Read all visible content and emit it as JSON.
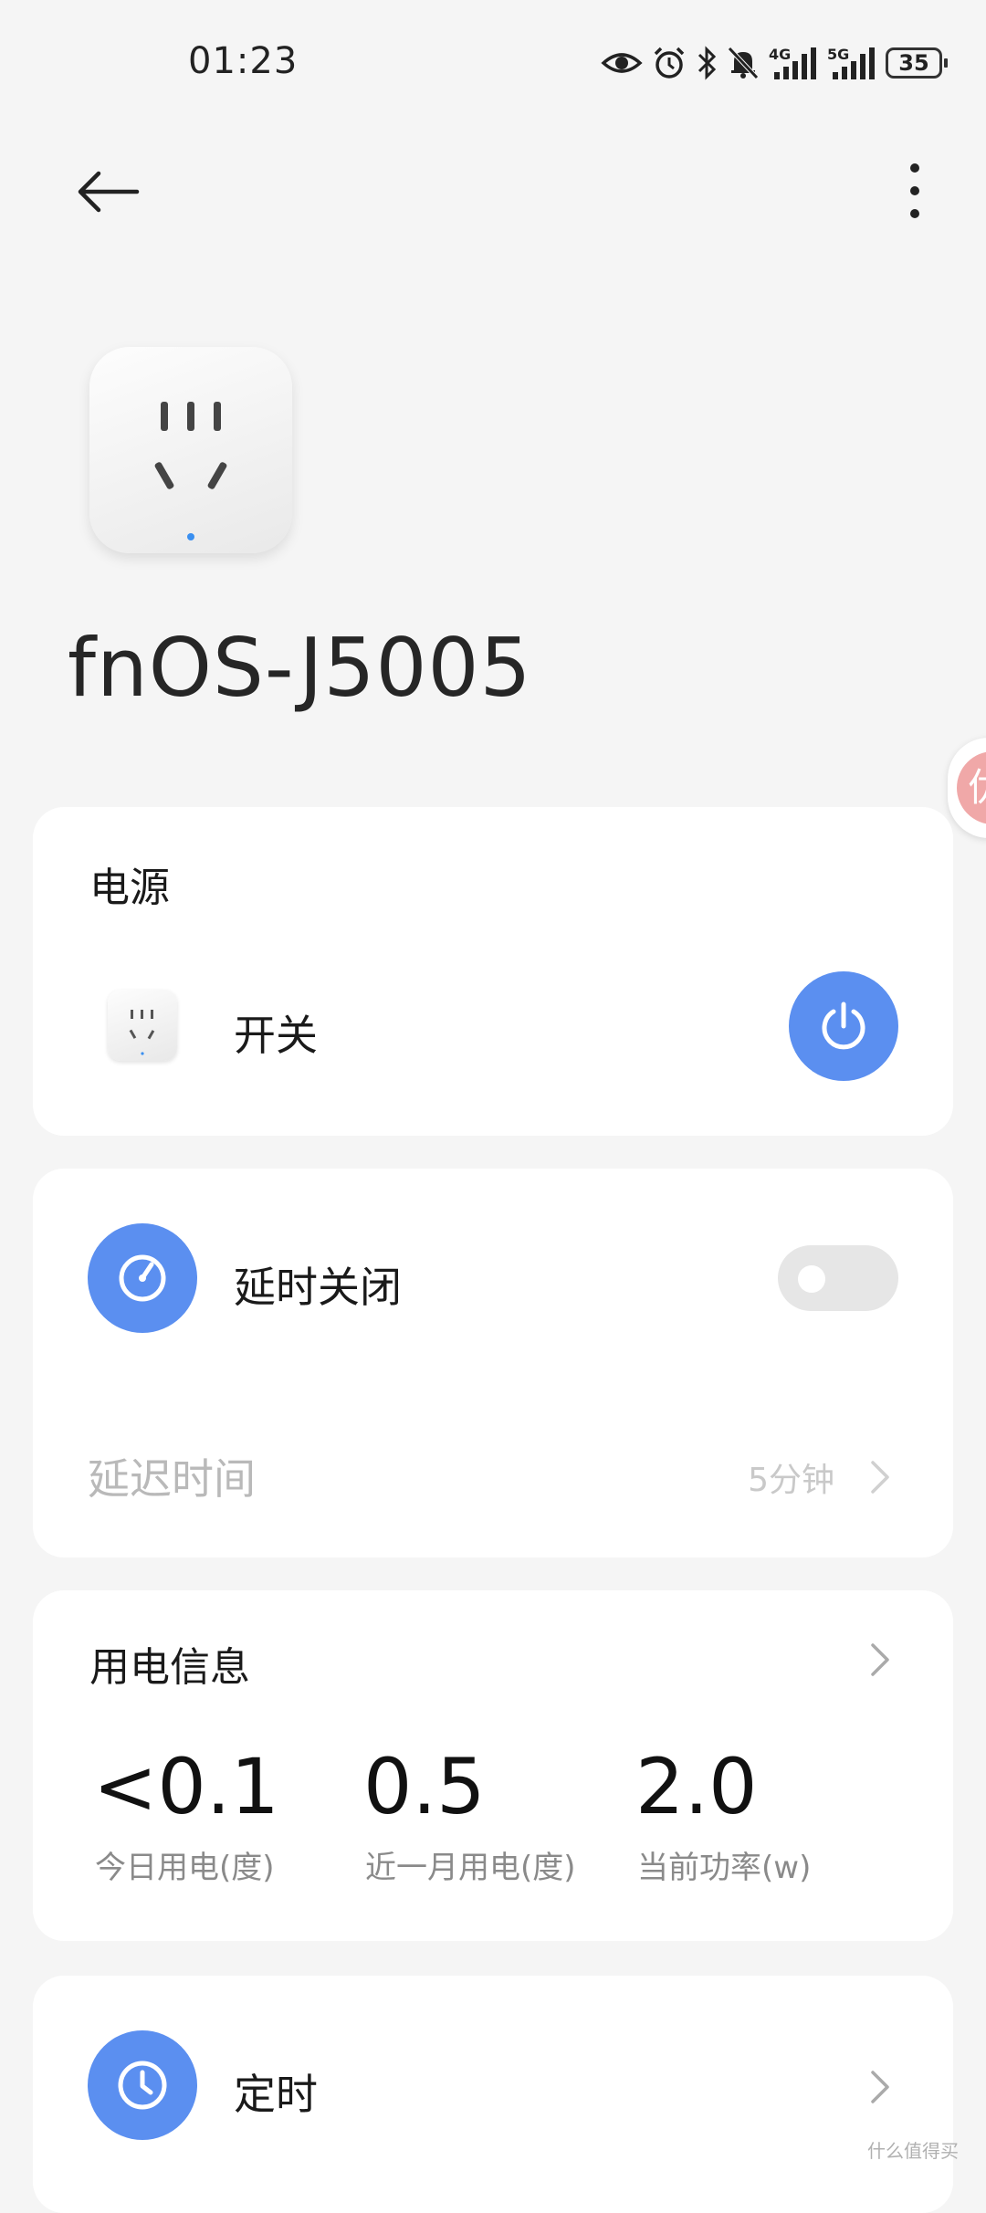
{
  "status_bar": {
    "time": "01:23",
    "icons": [
      "eye-icon",
      "alarm-icon",
      "bluetooth-icon",
      "mute-bell-icon",
      "4g-signal-icon",
      "5g-signal-icon"
    ],
    "net1": "4G",
    "net2": "5G",
    "battery": "35"
  },
  "device": {
    "name": "fnOS-J5005"
  },
  "power_card": {
    "title": "电源",
    "switch_label": "开关"
  },
  "delay_card": {
    "label": "延时关闭",
    "delay_time_label": "延迟时间",
    "delay_time_value": "5分钟",
    "toggle_on": false
  },
  "electricity_card": {
    "title": "用电信息",
    "stats": [
      {
        "value": "<0.1",
        "label": "今日用电(度)"
      },
      {
        "value": "0.5",
        "label": "近一月用电(度)"
      },
      {
        "value": "2.0",
        "label": "当前功率(w)"
      }
    ]
  },
  "timer_card": {
    "label": "定时"
  },
  "floating_tab": {
    "text": "优"
  },
  "watermark": {
    "text": "什么值得买"
  },
  "colors": {
    "accent": "#5b8ff0",
    "background": "#f5f5f5",
    "card": "#ffffff"
  }
}
